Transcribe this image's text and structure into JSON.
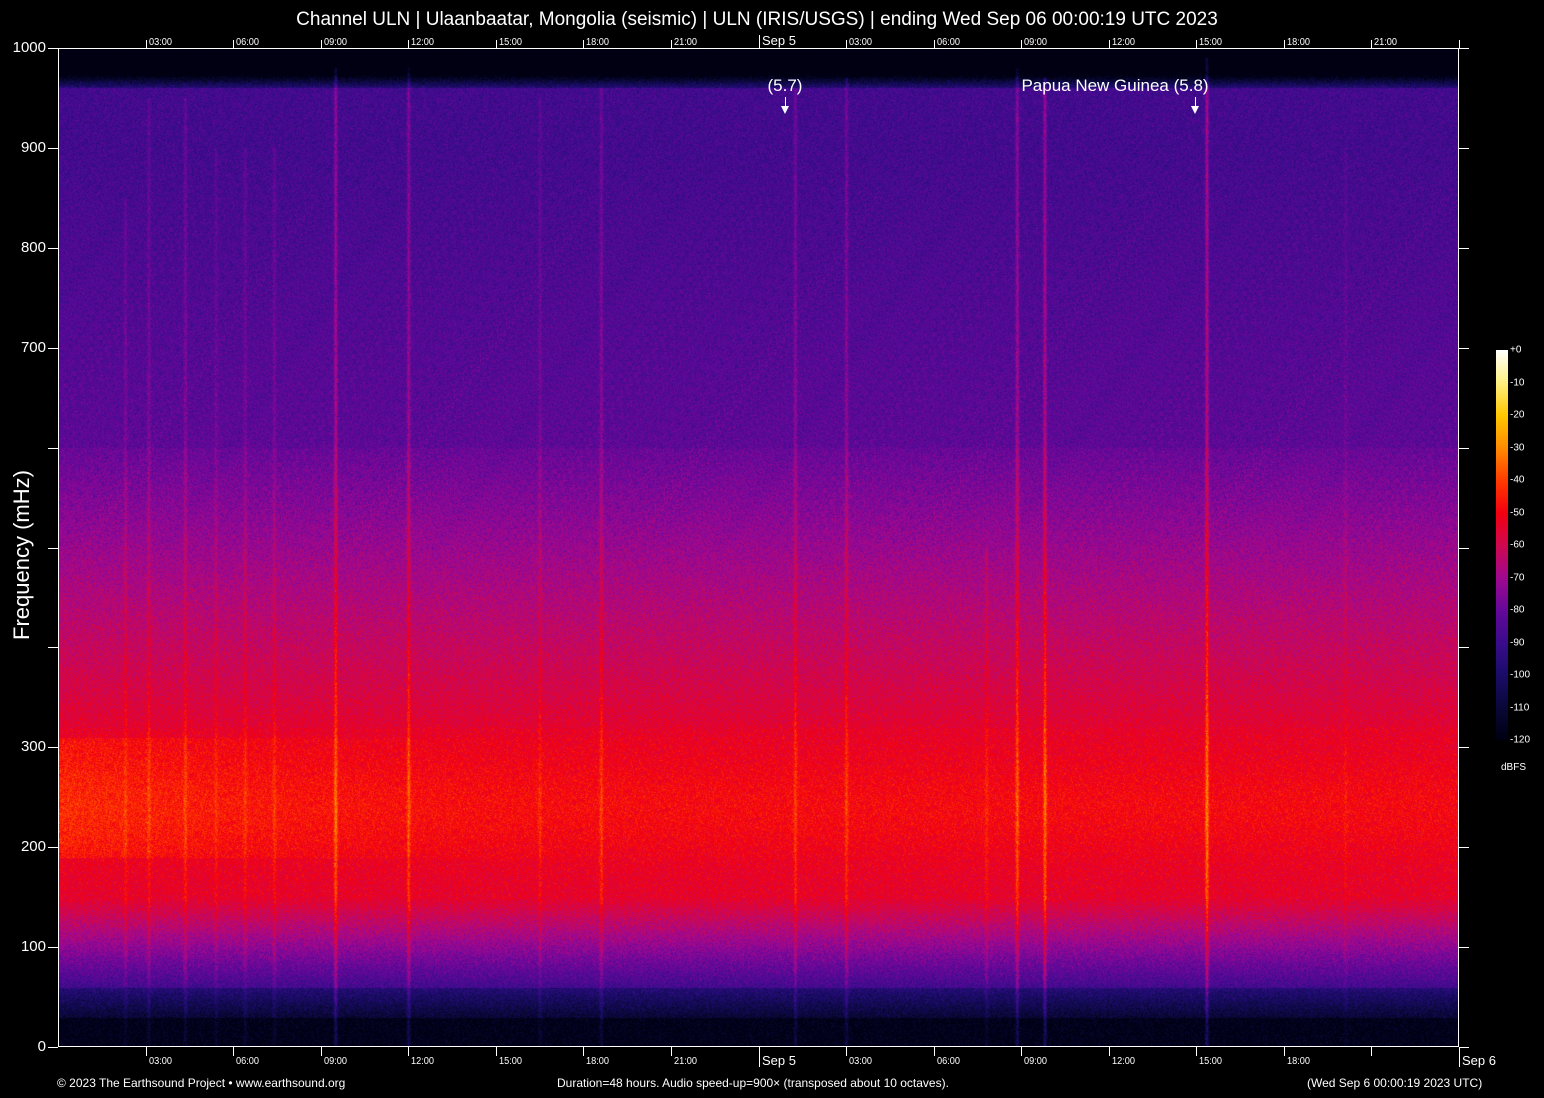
{
  "chart_data": {
    "type": "heatmap",
    "title": "Channel ULN | Ulaanbaatar, Mongolia (seismic) | ULN (IRIS/USGS) | ending Wed Sep 06 00:00:19 UTC 2023",
    "ylabel": "Frequency (mHz)",
    "ylim": [
      0,
      1000
    ],
    "xlim_hours": [
      0,
      48
    ],
    "y_ticks": [
      0,
      100,
      200,
      300,
      400,
      500,
      600,
      700,
      800,
      900,
      1000
    ],
    "y_tick_labels": [
      {
        "value": 0,
        "label": "0"
      },
      {
        "value": 100,
        "label": "100"
      },
      {
        "value": 200,
        "label": "200"
      },
      {
        "value": 300,
        "label": "300"
      },
      {
        "value": 700,
        "label": "700"
      },
      {
        "value": 800,
        "label": "800"
      },
      {
        "value": 900,
        "label": "900"
      },
      {
        "value": 1000,
        "label": "1000"
      }
    ],
    "top_x_ticks": [
      {
        "hour": 3,
        "label": "03:00"
      },
      {
        "hour": 6,
        "label": "06:00"
      },
      {
        "hour": 9,
        "label": "09:00"
      },
      {
        "hour": 12,
        "label": "12:00"
      },
      {
        "hour": 15,
        "label": "15:00"
      },
      {
        "hour": 18,
        "label": "18:00"
      },
      {
        "hour": 21,
        "label": "21:00"
      },
      {
        "hour": 24,
        "label": "Sep  5",
        "day": true
      },
      {
        "hour": 27,
        "label": "03:00"
      },
      {
        "hour": 30,
        "label": "06:00"
      },
      {
        "hour": 33,
        "label": "09:00"
      },
      {
        "hour": 36,
        "label": "12:00"
      },
      {
        "hour": 39,
        "label": "15:00"
      },
      {
        "hour": 42,
        "label": "18:00"
      },
      {
        "hour": 45,
        "label": "21:00"
      },
      {
        "hour": 48,
        "label": ""
      }
    ],
    "bottom_x_ticks": [
      {
        "hour": 3,
        "label": "03:00"
      },
      {
        "hour": 6,
        "label": "06:00"
      },
      {
        "hour": 9,
        "label": "09:00"
      },
      {
        "hour": 12,
        "label": "12:00"
      },
      {
        "hour": 15,
        "label": "15:00"
      },
      {
        "hour": 18,
        "label": "18:00"
      },
      {
        "hour": 21,
        "label": "21:00"
      },
      {
        "hour": 24,
        "label": "Sep  5",
        "day": true
      },
      {
        "hour": 27,
        "label": "03:00"
      },
      {
        "hour": 30,
        "label": "06:00"
      },
      {
        "hour": 33,
        "label": "09:00"
      },
      {
        "hour": 36,
        "label": "12:00"
      },
      {
        "hour": 39,
        "label": "15:00"
      },
      {
        "hour": 42,
        "label": "18:00"
      },
      {
        "hour": 45,
        "label": ""
      },
      {
        "hour": 48,
        "label": "Sep  6",
        "day": true
      }
    ],
    "annotations": [
      {
        "hour": 24.9,
        "label": "(5.7)"
      },
      {
        "hour": 38.95,
        "label": "Papua New Guinea (5.8)"
      }
    ],
    "events": [
      {
        "hour": 2.3,
        "boost": 6,
        "fmax": 850
      },
      {
        "hour": 3.1,
        "boost": 7,
        "fmax": 950
      },
      {
        "hour": 4.35,
        "boost": 8,
        "fmax": 950
      },
      {
        "hour": 5.4,
        "boost": 5,
        "fmax": 900
      },
      {
        "hour": 6.4,
        "boost": 6,
        "fmax": 900
      },
      {
        "hour": 7.4,
        "boost": 6,
        "fmax": 900
      },
      {
        "hour": 9.5,
        "boost": 16,
        "fmax": 980
      },
      {
        "hour": 12.0,
        "boost": 13,
        "fmax": 980
      },
      {
        "hour": 16.5,
        "boost": 6,
        "fmax": 950
      },
      {
        "hour": 18.6,
        "boost": 10,
        "fmax": 960
      },
      {
        "hour": 25.25,
        "boost": 10,
        "fmax": 960
      },
      {
        "hour": 27.0,
        "boost": 10,
        "fmax": 970
      },
      {
        "hour": 31.8,
        "boost": 6,
        "fmax": 500
      },
      {
        "hour": 32.85,
        "boost": 15,
        "fmax": 980
      },
      {
        "hour": 33.8,
        "boost": 17,
        "fmax": 970
      },
      {
        "hour": 39.35,
        "boost": 19,
        "fmax": 990
      },
      {
        "hour": 44.1,
        "boost": 4,
        "fmax": 900
      }
    ],
    "colorbar": {
      "label": "dBFS",
      "range": [
        -120,
        0
      ],
      "ticks": [
        "+0",
        "-10",
        "-20",
        "-30",
        "-40",
        "-50",
        "-60",
        "-70",
        "-80",
        "-90",
        "-100",
        "-110",
        "-120"
      ],
      "stops": [
        {
          "db": -120,
          "color": "#000012"
        },
        {
          "db": -110,
          "color": "#0a0838"
        },
        {
          "db": -100,
          "color": "#1a0c68"
        },
        {
          "db": -90,
          "color": "#3a0c8c"
        },
        {
          "db": -80,
          "color": "#66089a"
        },
        {
          "db": -70,
          "color": "#a00890"
        },
        {
          "db": -60,
          "color": "#d00850"
        },
        {
          "db": -50,
          "color": "#f40010"
        },
        {
          "db": -40,
          "color": "#ff3c00"
        },
        {
          "db": -30,
          "color": "#ff8c00"
        },
        {
          "db": -20,
          "color": "#ffc800"
        },
        {
          "db": -10,
          "color": "#fff080"
        },
        {
          "db": 0,
          "color": "#ffffff"
        }
      ]
    }
  },
  "footer": {
    "copyright": "© 2023 The Earthsound Project • www.earthsound.org",
    "duration": "Duration=48 hours. Audio speed-up=900× (transposed about 10 octaves).",
    "end_time": "(Wed Sep  6 00:00:19 2023 UTC)"
  }
}
